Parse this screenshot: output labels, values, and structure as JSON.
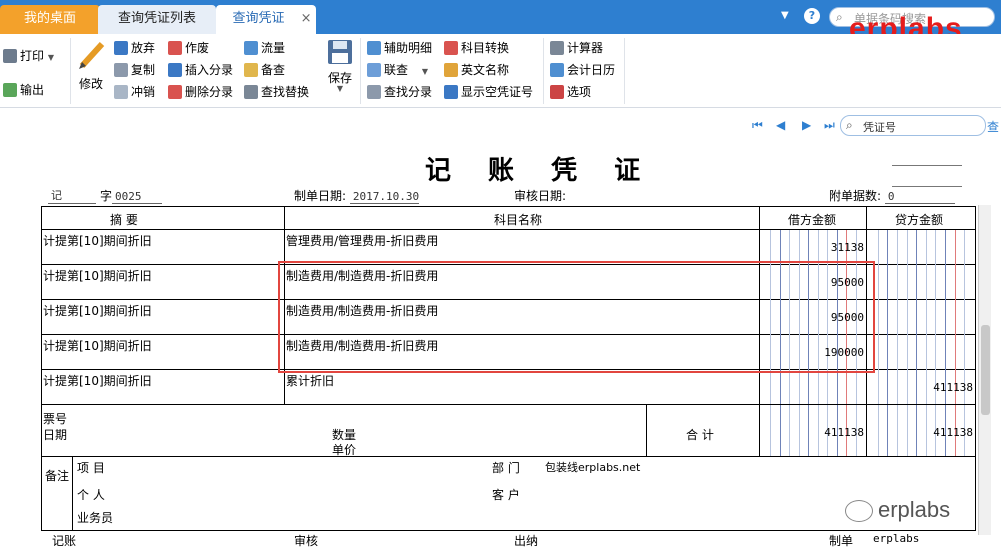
{
  "tabs": {
    "home": "我的桌面",
    "list": "查询凭证列表",
    "active": "查询凭证",
    "close": "×",
    "search_placeholder": "单据条码搜索"
  },
  "brand": "erplabs",
  "ribbon": {
    "print": "打印",
    "export": "输出",
    "edit": "修改",
    "discard": "放弃",
    "copy": "复制",
    "reverse": "冲销",
    "void": "作废",
    "insert_entry": "插入分录",
    "delete_entry": "删除分录",
    "cashflow": "流量",
    "memo": "备查",
    "find_replace": "查找替换",
    "save": "保存",
    "aux_detail": "辅助明细",
    "linked_query": "联查",
    "find_entry": "查找分录",
    "account_convert": "科目转换",
    "english_name": "英文名称",
    "show_empty": "显示空凭证号",
    "calculator": "计算器",
    "calendar": "会计日历",
    "options": "选项"
  },
  "nav": {
    "search_placeholder": "凭证号",
    "search_link": "查"
  },
  "voucher": {
    "title": "记 账 凭 证",
    "type": "记",
    "zi": "字",
    "number": "0025",
    "date_label": "制单日期:",
    "date": "2017.10.30",
    "audit_date_label": "审核日期:",
    "attach_label": "附单据数:",
    "attach_count": "0",
    "columns": {
      "summary": "摘 要",
      "account": "科目名称",
      "debit": "借方金额",
      "credit": "贷方金额"
    },
    "rows": [
      {
        "summary": "计提第[10]期间折旧",
        "account": "管理费用/管理费用-折旧费用",
        "debit": "31138",
        "credit": ""
      },
      {
        "summary": "计提第[10]期间折旧",
        "account": "制造费用/制造费用-折旧费用",
        "debit": "95000",
        "credit": ""
      },
      {
        "summary": "计提第[10]期间折旧",
        "account": "制造费用/制造费用-折旧费用",
        "debit": "95000",
        "credit": ""
      },
      {
        "summary": "计提第[10]期间折旧",
        "account": "制造费用/制造费用-折旧费用",
        "debit": "190000",
        "credit": ""
      },
      {
        "summary": "计提第[10]期间折旧",
        "account": "累计折旧",
        "debit": "",
        "credit": "411138"
      }
    ],
    "footer": {
      "ticket_no": "票号",
      "date": "日期",
      "qty": "数量",
      "unit_price": "单价",
      "total_label": "合 计",
      "total_debit": "411138",
      "total_credit": "411138",
      "notes": "备注",
      "project": "项 目",
      "department": "部 门",
      "department_value": "包装线erplabs.net",
      "person": "个 人",
      "customer": "客 户",
      "salesman": "业务员"
    },
    "signatures": {
      "bookkeeper": "记账",
      "auditor": "审核",
      "cashier": "出纳",
      "preparer": "制单",
      "preparer_value": "erplabs"
    }
  },
  "watermark": "erplabs"
}
